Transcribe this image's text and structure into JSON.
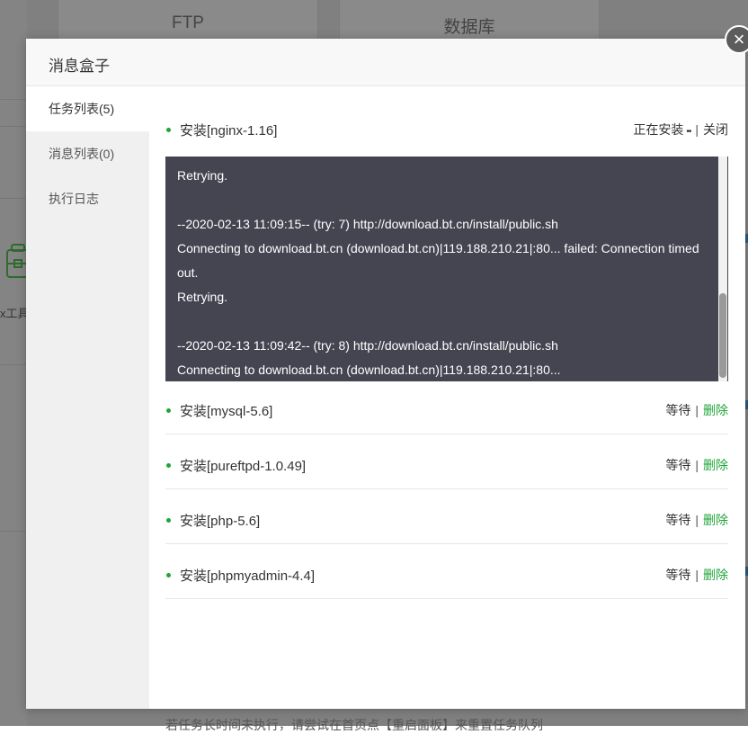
{
  "background": {
    "cards": [
      "FTP",
      "数据库"
    ],
    "tool_label": "x工具"
  },
  "modal": {
    "title": "消息盒子",
    "close_icon": "×"
  },
  "sidebar": {
    "items": [
      {
        "label": "任务列表(5)",
        "active": true
      },
      {
        "label": "消息列表(0)",
        "active": false
      },
      {
        "label": "执行日志",
        "active": false
      }
    ]
  },
  "tasks": [
    {
      "name": "安装[nginx-1.16]",
      "status": "正在安装",
      "status_dots": "••",
      "action": "关闭",
      "log": [
        "Retrying.",
        "",
        "--2020-02-13 11:09:15-- (try: 7) http://download.bt.cn/install/public.sh",
        "Connecting to download.bt.cn (download.bt.cn)|119.188.210.21|:80... failed: Connection timed out.",
        "Retrying.",
        "",
        "--2020-02-13 11:09:42-- (try: 8) http://download.bt.cn/install/public.sh",
        "Connecting to download.bt.cn (download.bt.cn)|119.188.210.21|:80..."
      ]
    },
    {
      "name": "安装[mysql-5.6]",
      "status": "等待",
      "action": "删除"
    },
    {
      "name": "安装[pureftpd-1.0.49]",
      "status": "等待",
      "action": "删除"
    },
    {
      "name": "安装[php-5.6]",
      "status": "等待",
      "action": "删除"
    },
    {
      "name": "安装[phpmyadmin-4.4]",
      "status": "等待",
      "action": "删除"
    }
  ],
  "separator": "|",
  "footer_note": "若任务长时间未执行，请尝试在首页点【重启面板】来重置任务队列",
  "colors": {
    "accent_green": "#20a53a",
    "log_bg": "#454552",
    "overlay": "#808080"
  }
}
